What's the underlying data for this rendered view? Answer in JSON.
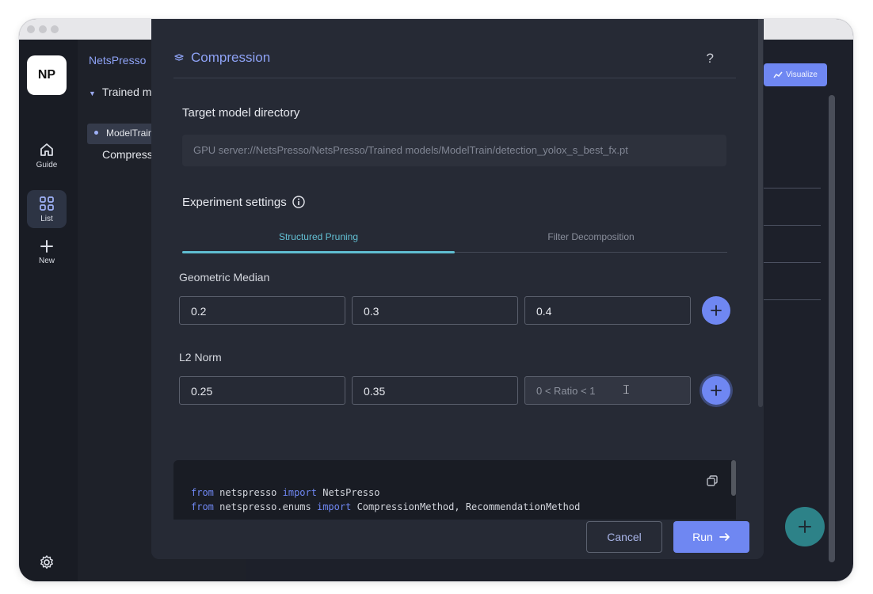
{
  "app": {
    "logo": "NP",
    "rail": [
      {
        "label": "Guide",
        "icon": "home-icon"
      },
      {
        "label": "List",
        "icon": "grid-icon"
      },
      {
        "label": "New",
        "icon": "plus-icon"
      }
    ],
    "settings_icon": "gear-icon"
  },
  "tree": {
    "brand": "NetsPresso",
    "folder": "Trained m",
    "selected": "ModelTrain",
    "child": "Compress"
  },
  "background": {
    "visualize_label": "Visualize"
  },
  "modal": {
    "title": "Compression",
    "help": "?",
    "target_label": "Target model directory",
    "target_value": "GPU server://NetsPresso/NetsPresso/Trained models/ModelTrain/detection_yolox_s_best_fx.pt",
    "experiment_label": "Experiment settings",
    "tabs": [
      {
        "label": "Structured Pruning",
        "active": true
      },
      {
        "label": "Filter Decomposition",
        "active": false
      }
    ],
    "sections": [
      {
        "label": "Geometric Median",
        "values": [
          "0.2",
          "0.3",
          "0.4"
        ]
      },
      {
        "label": "L2 Norm",
        "values": [
          "0.25",
          "0.35"
        ],
        "placeholder": "0 < Ratio < 1"
      }
    ],
    "code": [
      {
        "kw1": "from",
        "mod": "netspresso",
        "kw2": "import",
        "names": "NetsPresso"
      },
      {
        "kw1": "from",
        "mod": "netspresso.enums",
        "kw2": "import",
        "names": "CompressionMethod, RecommendationMethod"
      }
    ],
    "cancel_label": "Cancel",
    "run_label": "Run"
  },
  "colors": {
    "accent": "#6f87f2",
    "tab_active": "#5fbdd1",
    "fab": "#2d8288"
  }
}
